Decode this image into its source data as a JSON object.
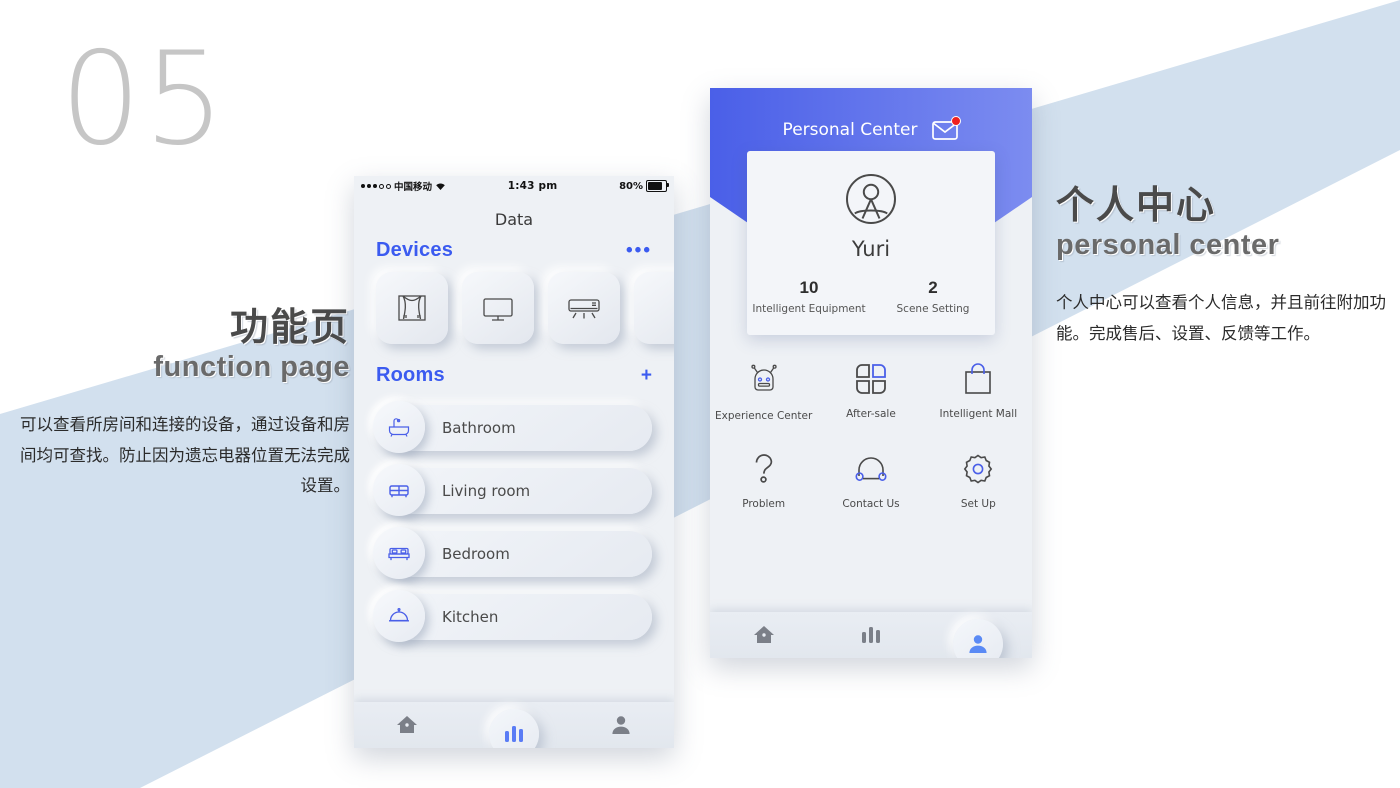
{
  "slide": {
    "section_number": "05",
    "background_band_color": "#d2e0ee"
  },
  "left_caption": {
    "heading_cn": "功能页",
    "heading_en": "function page",
    "body_cn": "可以查看所房间和连接的设备，通过设备和房间均可查找。防止因为遗忘电器位置无法完成设置。"
  },
  "right_caption": {
    "heading_cn": "个人中心",
    "heading_en": "personal center",
    "body_cn": "个人中心可以查看个人信息，并且前往附加功能。完成售后、设置、反馈等工作。"
  },
  "phone_left": {
    "status_bar": {
      "carrier": "中国移动",
      "time": "1:43 pm",
      "battery": "80%",
      "wifi_icon": "wifi-icon",
      "signal_icon": "signal-dots-icon",
      "battery_icon": "battery-icon"
    },
    "page_title": "Data",
    "devices_section": {
      "title": "Devices",
      "more_label": "•••",
      "cards": [
        {
          "icon": "curtain-icon"
        },
        {
          "icon": "television-icon"
        },
        {
          "icon": "air-conditioner-icon"
        },
        {
          "icon": "partial-device-icon"
        }
      ]
    },
    "rooms_section": {
      "title": "Rooms",
      "add_label": "+",
      "items": [
        {
          "label": "Bathroom",
          "icon": "bathtub-icon"
        },
        {
          "label": "Living room",
          "icon": "sofa-icon"
        },
        {
          "label": "Bedroom",
          "icon": "bed-icon"
        },
        {
          "label": "Kitchen",
          "icon": "cloche-icon"
        }
      ]
    },
    "tabbar": {
      "items": [
        {
          "name": "home",
          "icon": "home-icon",
          "active": false
        },
        {
          "name": "data",
          "icon": "bar-chart-icon",
          "active": true
        },
        {
          "name": "profile",
          "icon": "person-icon",
          "active": false
        }
      ],
      "active_color": "#5a7cf5",
      "inactive_color": "#7b7f88"
    }
  },
  "phone_right": {
    "header": {
      "title": "Personal Center",
      "mail_icon": "mail-icon",
      "has_unread_badge": true,
      "gradient_from": "#4a5fe8",
      "gradient_to": "#7c8cf0"
    },
    "profile_card": {
      "avatar_icon": "user-avatar-icon",
      "username": "Yuri",
      "stats": [
        {
          "value": "10",
          "label": "Intelligent Equipment"
        },
        {
          "value": "2",
          "label": "Scene Setting"
        }
      ]
    },
    "menu_grid": [
      [
        {
          "label": "Experience Center",
          "icon": "robot-icon"
        },
        {
          "label": "After-sale",
          "icon": "four-squares-icon"
        },
        {
          "label": "Intelligent Mall",
          "icon": "shopping-bag-icon"
        }
      ],
      [
        {
          "label": "Problem",
          "icon": "question-mark-icon"
        },
        {
          "label": "Contact Us",
          "icon": "headset-icon"
        },
        {
          "label": "Set Up",
          "icon": "gear-icon"
        }
      ]
    ],
    "tabbar": {
      "items": [
        {
          "name": "home",
          "icon": "home-icon",
          "active": false
        },
        {
          "name": "data",
          "icon": "bar-chart-icon",
          "active": false
        },
        {
          "name": "profile",
          "icon": "person-icon",
          "active": true
        }
      ],
      "active_color": "#5a8af5",
      "inactive_color": "#7b7f88"
    }
  }
}
